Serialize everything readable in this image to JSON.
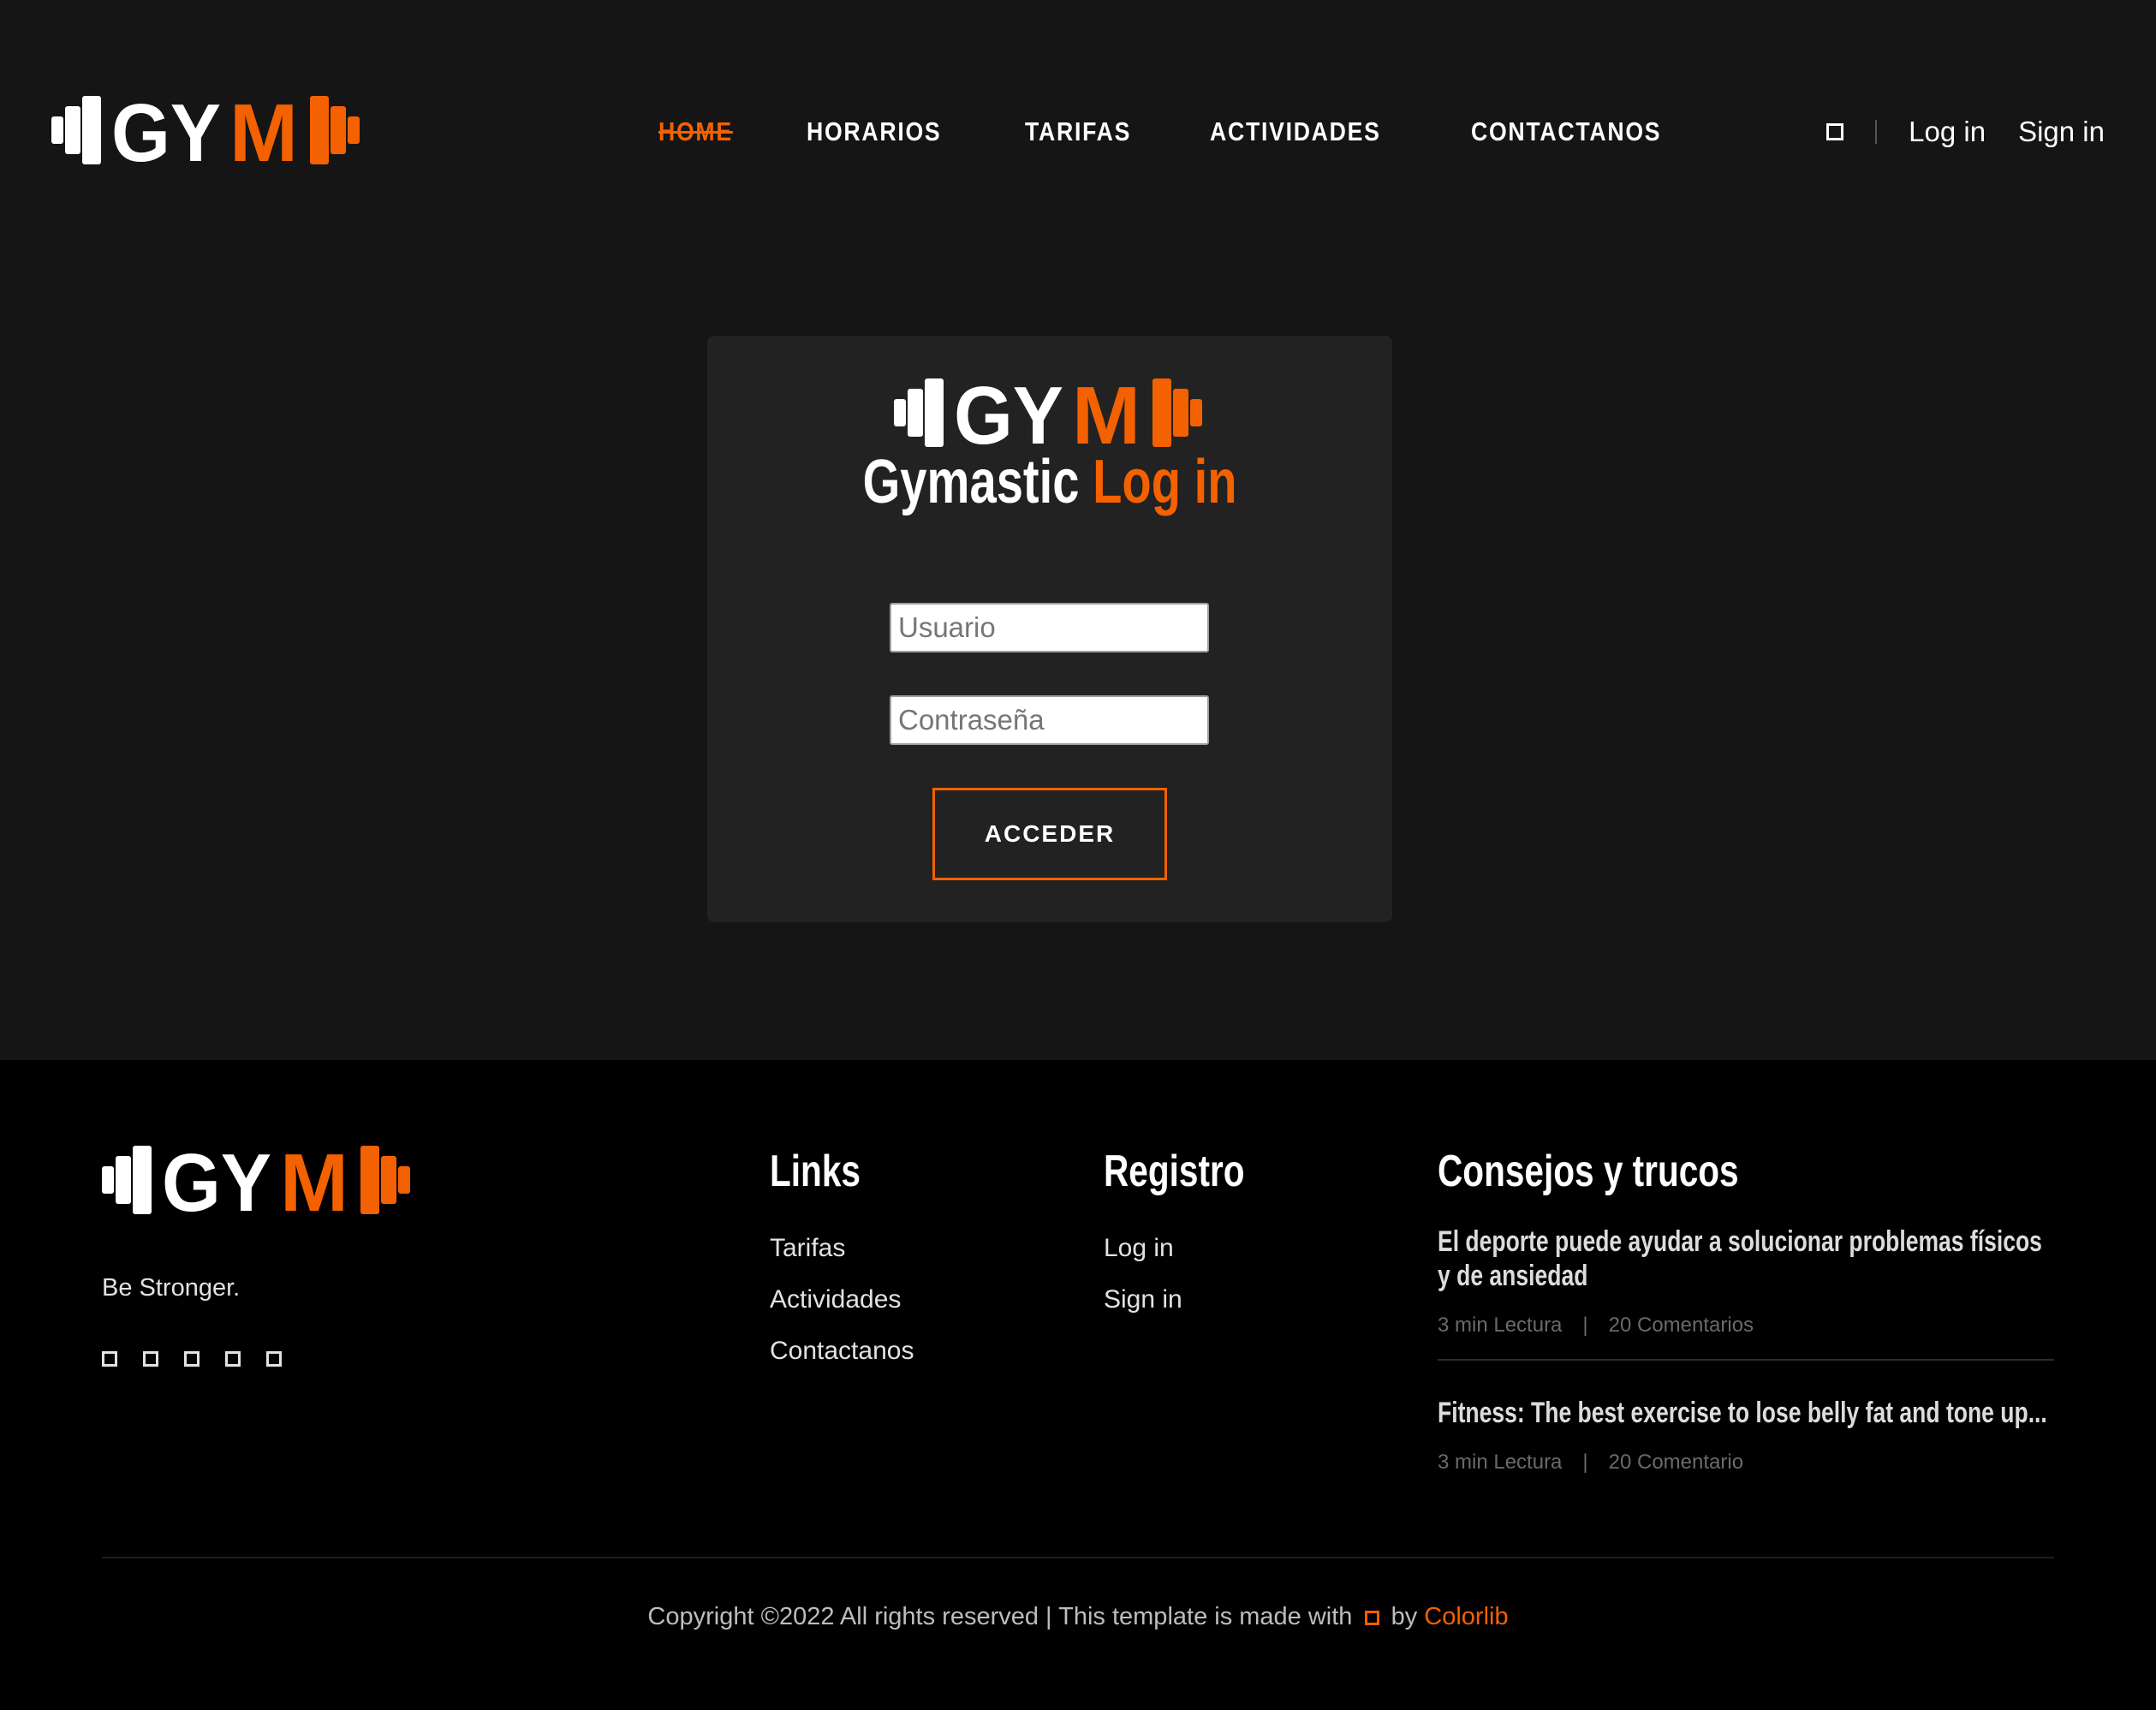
{
  "brand": {
    "logo_text_white": "GY",
    "logo_text_accent": "M",
    "accent_color": "#f36100"
  },
  "nav": {
    "items": [
      {
        "label": "HOME",
        "active": true
      },
      {
        "label": "HORARIOS",
        "active": false
      },
      {
        "label": "TARIFAS",
        "active": false
      },
      {
        "label": "ACTIVIDADES",
        "active": false
      },
      {
        "label": "CONTACTANOS",
        "active": false
      }
    ]
  },
  "header_right": {
    "icon": "square-icon",
    "login_label": "Log in",
    "signin_label": "Sign in"
  },
  "login": {
    "title_prefix": "Gymastic",
    "title_accent": "Log in",
    "username_placeholder": "Usuario",
    "password_placeholder": "Contraseña",
    "submit_label": "ACCEDER"
  },
  "footer": {
    "tagline": "Be Stronger.",
    "social_icons": [
      "square-icon",
      "square-icon",
      "square-icon",
      "square-icon",
      "square-icon"
    ],
    "links_title": "Links",
    "links": [
      "Tarifas",
      "Actividades",
      "Contactanos"
    ],
    "registro_title": "Registro",
    "registro_links": [
      "Log in",
      "Sign in"
    ],
    "tips_title": "Consejos y trucos",
    "posts": [
      {
        "title": "El deporte puede ayudar a solucionar problemas físicos y de ansiedad",
        "read": "3 min Lectura",
        "comments": "20 Comentarios"
      },
      {
        "title": "Fitness: The best exercise to lose belly fat and tone up...",
        "read": "3 min Lectura",
        "comments": "20 Comentario"
      }
    ],
    "copyright_prefix": "Copyright ©2022 All rights reserved | This template is made with",
    "copyright_by": "by",
    "copyright_brand": "Colorlib"
  }
}
